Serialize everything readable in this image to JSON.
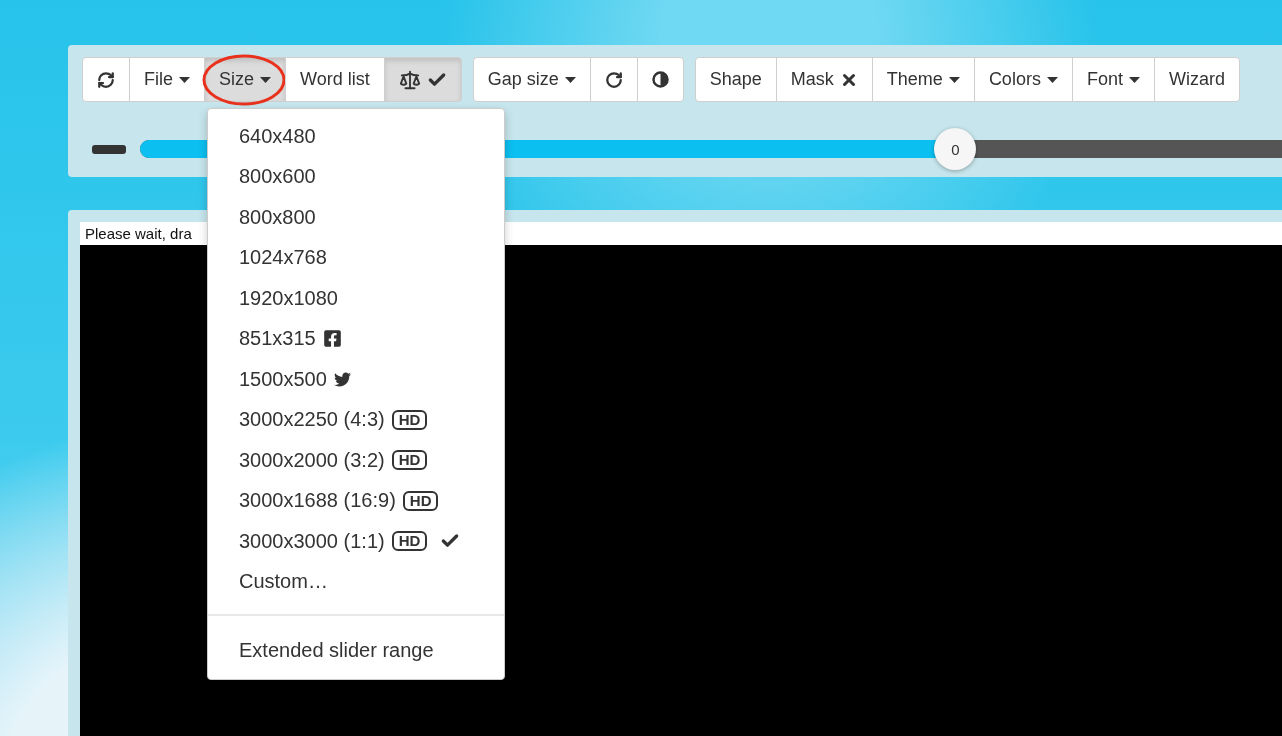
{
  "toolbar": {
    "groups": [
      {
        "buttons": [
          {
            "kind": "refresh",
            "pressed": false
          },
          {
            "kind": "menu",
            "label": "File",
            "pressed": false
          },
          {
            "kind": "menu",
            "label": "Size",
            "pressed": true,
            "highlighted": true
          },
          {
            "kind": "text",
            "label": "Word list",
            "pressed": false
          },
          {
            "kind": "balance",
            "pressed": true
          }
        ]
      },
      {
        "buttons": [
          {
            "kind": "menu",
            "label": "Gap size",
            "pressed": false
          },
          {
            "kind": "redo",
            "pressed": false
          },
          {
            "kind": "contrast",
            "pressed": false
          }
        ]
      },
      {
        "buttons": [
          {
            "kind": "text",
            "label": "Shape",
            "pressed": false
          },
          {
            "kind": "close",
            "label": "Mask",
            "pressed": false
          },
          {
            "kind": "menu",
            "label": "Theme",
            "pressed": false
          },
          {
            "kind": "menu",
            "label": "Colors",
            "pressed": false
          },
          {
            "kind": "menu",
            "label": "Font",
            "pressed": false
          },
          {
            "kind": "text",
            "label": "Wizard",
            "pressed": false
          }
        ]
      }
    ]
  },
  "slider": {
    "level": 0.714,
    "value": "0"
  },
  "canvas": {
    "status": "Please wait, dra"
  },
  "size_menu": {
    "sections": [
      {
        "items": [
          {
            "label": "640x480",
            "checked": false
          },
          {
            "label": "800x600",
            "checked": false
          },
          {
            "label": "800x800",
            "checked": false
          },
          {
            "label": "1024x768",
            "checked": false
          },
          {
            "label": "1920x1080",
            "checked": false
          },
          {
            "label": "851x315",
            "kind": "facebook",
            "checked": false
          },
          {
            "label": "1500x500",
            "kind": "twitter",
            "checked": false
          },
          {
            "label": "3000x2250 (4:3)",
            "badge": "HD",
            "checked": false
          },
          {
            "label": "3000x2000 (3:2)",
            "badge": "HD",
            "checked": false
          },
          {
            "label": "3000x1688 (16:9)",
            "badge": "HD",
            "checked": false
          },
          {
            "label": "3000x3000 (1:1)",
            "badge": "HD",
            "checked": true
          },
          {
            "label": "Custom…",
            "checked": false
          }
        ]
      },
      {
        "items": [
          {
            "label": "Extended slider range",
            "checked": false
          }
        ]
      }
    ]
  }
}
